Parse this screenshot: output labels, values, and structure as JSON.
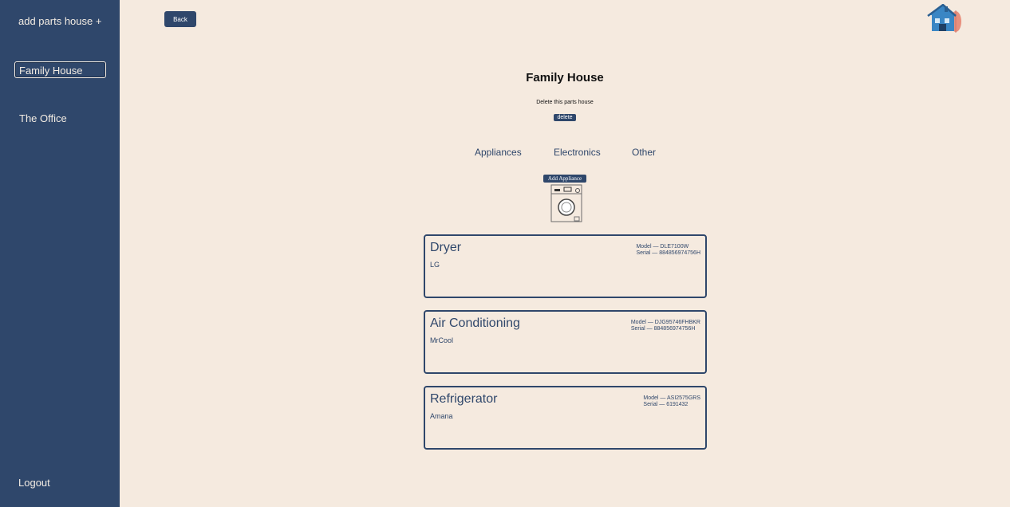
{
  "sidebar": {
    "add_label": "add parts house +",
    "houses": [
      {
        "label": "Family House",
        "active": true
      },
      {
        "label": "The Office",
        "active": false
      }
    ],
    "logout_label": "Logout"
  },
  "header": {
    "back_label": "Back",
    "logo_icon": "house-logo-icon"
  },
  "house": {
    "title": "Family House",
    "delete_prompt": "Delete this parts house",
    "delete_label": "delete"
  },
  "tabs": [
    "Appliances",
    "Electronics",
    "Other"
  ],
  "add_appliance_label": "Add Appliance",
  "appliances": [
    {
      "name": "Dryer",
      "brand": "LG",
      "model": "Model — DLE7100W",
      "serial": "Serial — 884856974756H"
    },
    {
      "name": "Air Conditioning",
      "brand": "MrCool",
      "model": "Model — DJG95746FHBKR",
      "serial": "Serial — 884856974756H"
    },
    {
      "name": "Refrigerator",
      "brand": "Amana",
      "model": "Model — ASI2575GRS",
      "serial": "Serial — 6191432"
    }
  ],
  "colors": {
    "sidebar": "#2f476b",
    "background": "#f5eadf",
    "accent": "#2f476b"
  }
}
